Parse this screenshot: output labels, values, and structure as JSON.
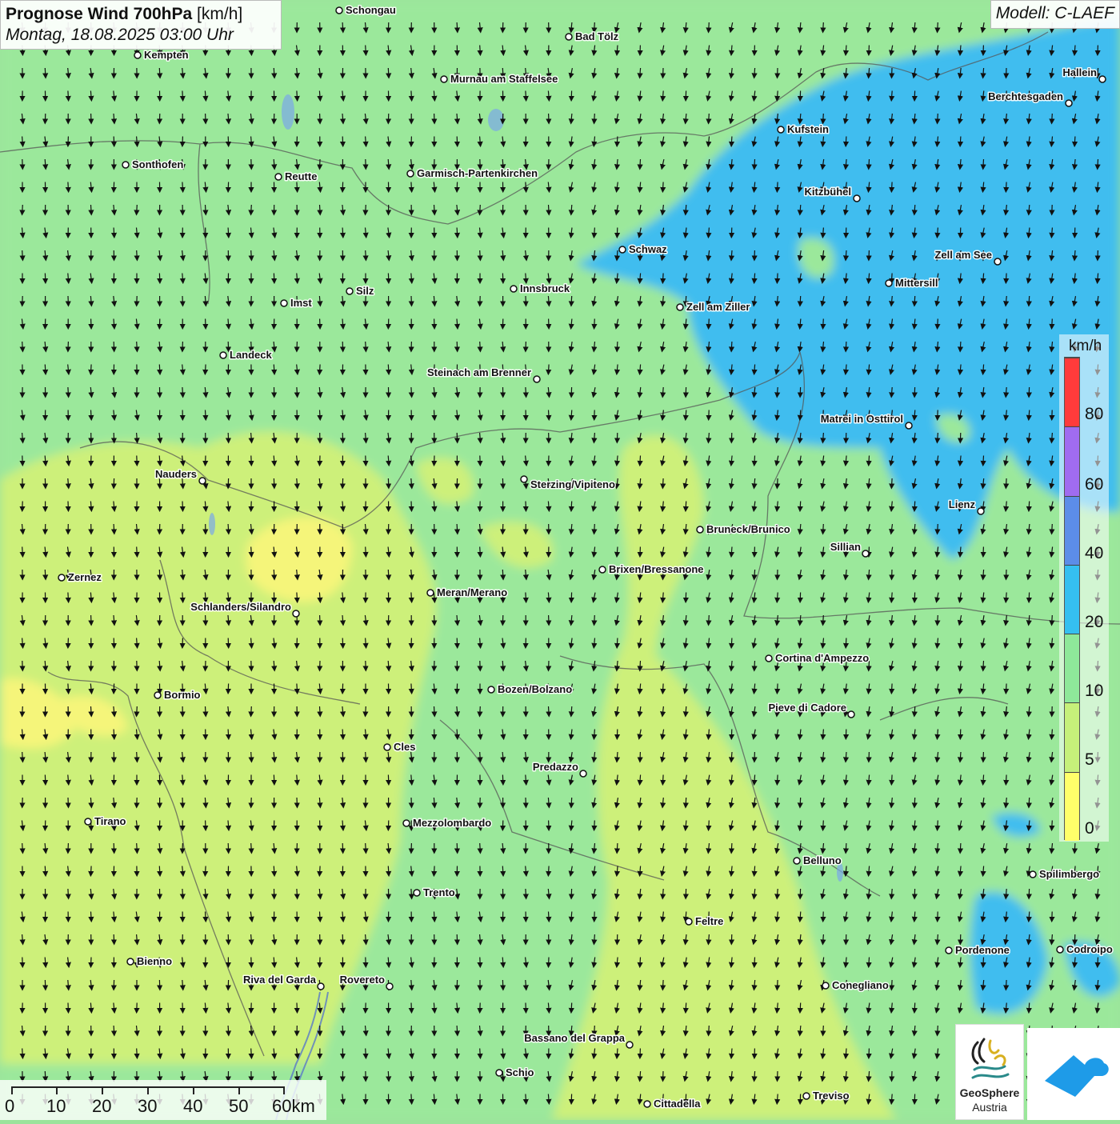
{
  "title": {
    "main": "Prognose Wind 700hPa",
    "unit": "[km/h]",
    "datetime": "Montag, 18.08.2025 03:00 Uhr"
  },
  "model_label": "Modell: C-LAEF",
  "legend": {
    "unit": "km/h",
    "ticks": [
      "80",
      "60",
      "40",
      "20",
      "10",
      "5",
      "0"
    ],
    "colors": [
      "#ff3b3b",
      "#a06cf0",
      "#5c8de8",
      "#35bff0",
      "#8ee89a",
      "#c6f07a",
      "#ffff6a"
    ]
  },
  "scale": {
    "labels": [
      "0",
      "10",
      "20",
      "30",
      "40",
      "50",
      "60km"
    ]
  },
  "logo": {
    "geosphere_line1": "GeoSphere",
    "geosphere_line2": "Austria"
  },
  "cities": [
    {
      "name": "Schongau"
    },
    {
      "name": "Bad Tölz"
    },
    {
      "name": "Kempten"
    },
    {
      "name": "Murnau am Staffelsee"
    },
    {
      "name": "Hallein"
    },
    {
      "name": "Berchtesgaden"
    },
    {
      "name": "Kufstein"
    },
    {
      "name": "Sonthofen"
    },
    {
      "name": "Reutte"
    },
    {
      "name": "Garmisch-Partenkirchen"
    },
    {
      "name": "Kitzbühel"
    },
    {
      "name": "Schwaz"
    },
    {
      "name": "Zell am See"
    },
    {
      "name": "Mittersill"
    },
    {
      "name": "Innsbruck"
    },
    {
      "name": "Silz"
    },
    {
      "name": "Imst"
    },
    {
      "name": "Zell am Ziller"
    },
    {
      "name": "Landeck"
    },
    {
      "name": "Steinach am Brenner"
    },
    {
      "name": "Matrei in Osttirol"
    },
    {
      "name": "Nauders"
    },
    {
      "name": "Sterzing/Vipiteno"
    },
    {
      "name": "Lienz"
    },
    {
      "name": "Bruneck/Brunico"
    },
    {
      "name": "Sillian"
    },
    {
      "name": "Brixen/Bressanone"
    },
    {
      "name": "Zernez"
    },
    {
      "name": "Meran/Merano"
    },
    {
      "name": "Schlanders/Silandro"
    },
    {
      "name": "Cortina d'Ampezzo"
    },
    {
      "name": "Bozen/Bolzano"
    },
    {
      "name": "Bormio"
    },
    {
      "name": "Pieve di Cadore"
    },
    {
      "name": "Cles"
    },
    {
      "name": "Predazzo"
    },
    {
      "name": "Tirano"
    },
    {
      "name": "Mezzolombardo"
    },
    {
      "name": "Belluno"
    },
    {
      "name": "Spilimbergo"
    },
    {
      "name": "Trento"
    },
    {
      "name": "Feltre"
    },
    {
      "name": "Bienno"
    },
    {
      "name": "Pordenone"
    },
    {
      "name": "Codroipo"
    },
    {
      "name": "Riva del Garda"
    },
    {
      "name": "Rovereto"
    },
    {
      "name": "Conegliano"
    },
    {
      "name": "Bassano del Grappa"
    },
    {
      "name": "Schio"
    },
    {
      "name": "Treviso"
    },
    {
      "name": "Cittadella"
    }
  ]
}
